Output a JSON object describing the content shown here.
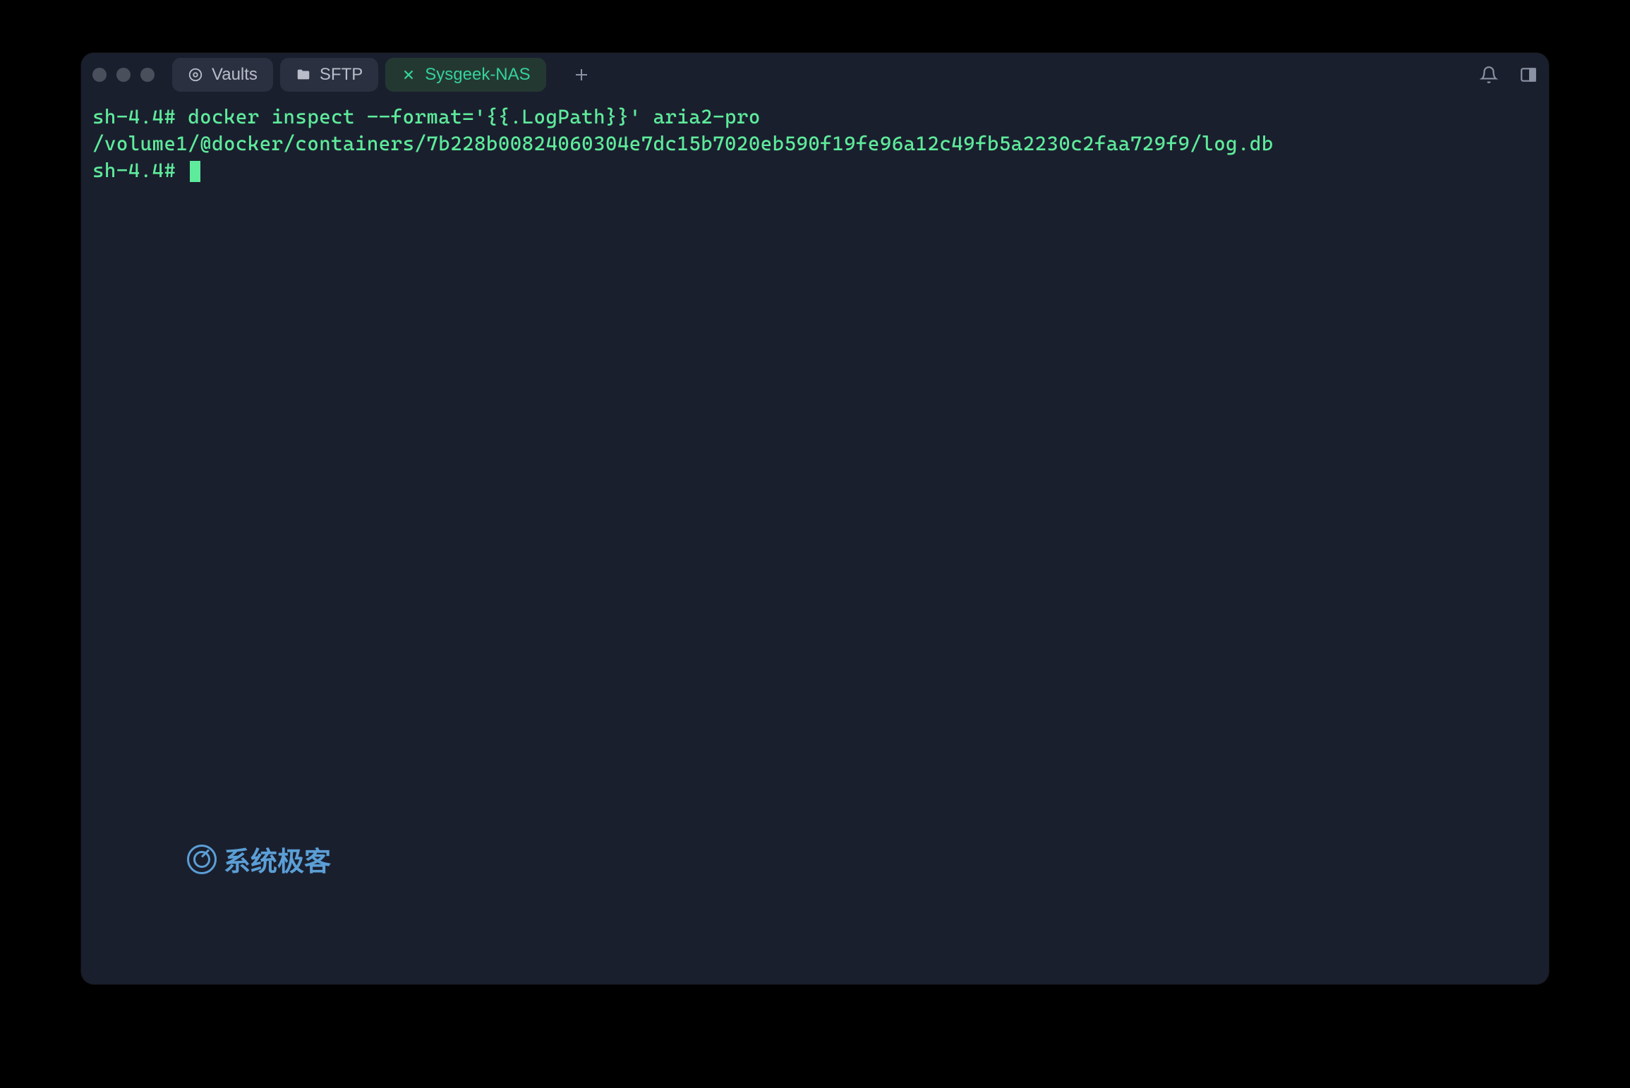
{
  "tabs": [
    {
      "label": "Vaults",
      "icon": "vault"
    },
    {
      "label": "SFTP",
      "icon": "folder"
    },
    {
      "label": "Sysgeek-NAS",
      "icon": "close",
      "active": true
    }
  ],
  "terminal": {
    "prompt1": "sh-4.4#",
    "command1": "docker inspect --format='{{.LogPath}}' aria2-pro",
    "output1": "/volume1/@docker/containers/7b228b00824060304e7dc15b7020eb590f19fe96a12c49fb5a2230c2faa729f9/log.db",
    "prompt2": "sh-4.4#"
  },
  "watermark": {
    "text": "系统极客"
  }
}
